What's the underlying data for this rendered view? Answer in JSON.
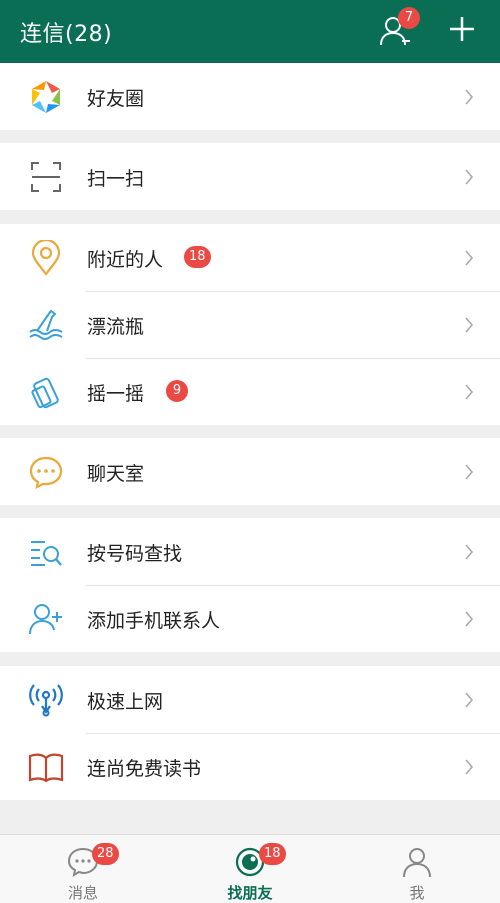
{
  "header": {
    "title": "连信(28)",
    "contacts_badge": "7"
  },
  "groups": [
    [
      {
        "label": "好友圈",
        "icon": "moments-icon"
      }
    ],
    [
      {
        "label": "扫一扫",
        "icon": "scan-icon"
      }
    ],
    [
      {
        "label": "附近的人",
        "icon": "location-pin-icon",
        "badge": "18"
      },
      {
        "label": "漂流瓶",
        "icon": "drift-bottle-icon"
      },
      {
        "label": "摇一摇",
        "icon": "shake-phone-icon",
        "badge": "9"
      }
    ],
    [
      {
        "label": "聊天室",
        "icon": "chat-bubble-icon"
      }
    ],
    [
      {
        "label": "按号码查找",
        "icon": "search-list-icon"
      },
      {
        "label": "添加手机联系人",
        "icon": "add-contact-icon"
      }
    ],
    [
      {
        "label": "极速上网",
        "icon": "wifi-signal-icon"
      },
      {
        "label": "连尚免费读书",
        "icon": "book-icon"
      }
    ]
  ],
  "tabs": [
    {
      "label": "消息",
      "badge": "28",
      "icon": "chat-bubble-icon"
    },
    {
      "label": "找朋友",
      "badge": "18",
      "icon": "discover-icon",
      "active": true
    },
    {
      "label": "我",
      "icon": "person-icon"
    }
  ],
  "colors": {
    "header": "#0a6e55",
    "badge": "#ea4a43",
    "active_tab": "#0a6e55"
  }
}
